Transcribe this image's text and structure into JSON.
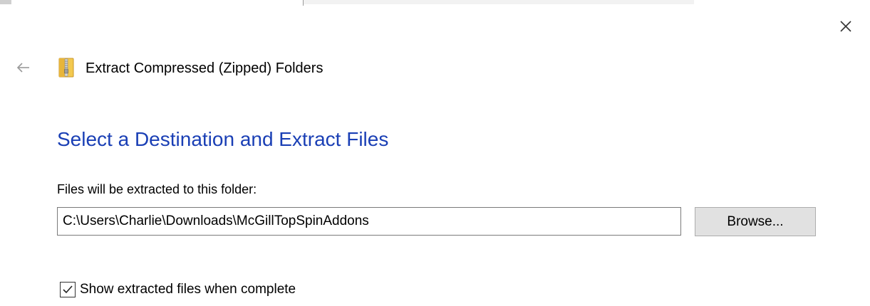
{
  "window": {
    "title": "Extract Compressed (Zipped) Folders"
  },
  "header": {
    "back_icon": "arrow-left-icon",
    "app_icon": "zipped-folder-icon",
    "close_icon": "close-icon"
  },
  "main": {
    "heading": "Select a Destination and Extract Files",
    "folder_label": "Files will be extracted to this folder:",
    "path_value": "C:\\Users\\Charlie\\Downloads\\McGillTopSpinAddons",
    "browse_label": "Browse...",
    "checkbox": {
      "label": "Show extracted files when complete",
      "checked": true
    }
  },
  "colors": {
    "heading": "#1a3fb5",
    "button_bg": "#e1e1e1",
    "button_border": "#adadad",
    "input_border": "#7a7a7a"
  }
}
